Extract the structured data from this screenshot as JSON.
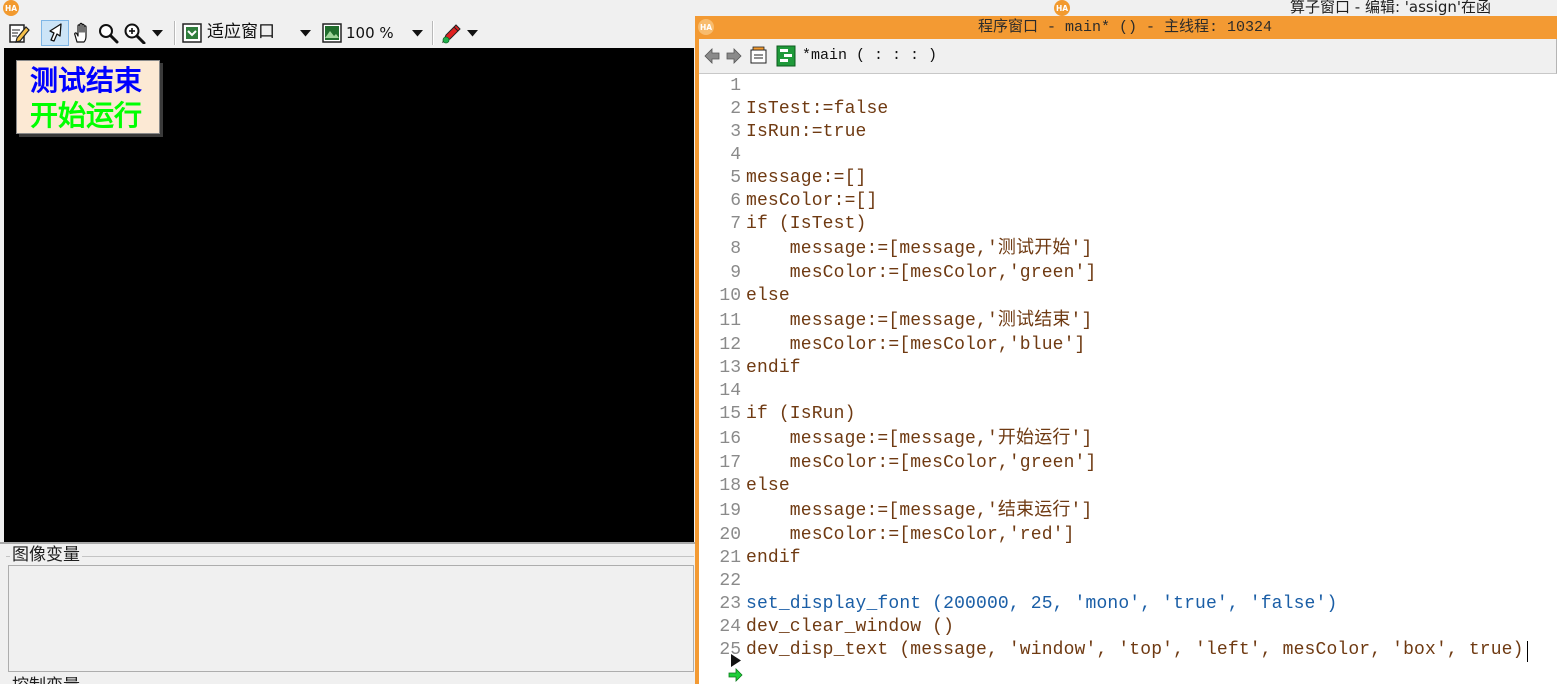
{
  "app": {
    "logo_text": "HA"
  },
  "top_strip": {
    "background_window_title": "算子窗口 - 编辑:  'assign'在函"
  },
  "graphics_window": {
    "toolbar": {
      "icons": [
        "edit-icon",
        "pointer-icon",
        "hand-icon",
        "magnifier-icon",
        "zoom-in-icon",
        "fit-window-icon",
        "image-zoom-icon",
        "draw-color-icon"
      ],
      "fit_window_label": "适应窗口",
      "zoom_label": "100 %"
    },
    "display": {
      "messages": [
        {
          "text": "测试结束",
          "color": "#0000ff"
        },
        {
          "text": "开始运行",
          "color": "#00ff00"
        }
      ]
    }
  },
  "variables_panel": {
    "image_variables_label": "图像变量",
    "control_variables_label": "控制变量"
  },
  "program_window": {
    "title": "程序窗口 - main* () - 主线程: 10324",
    "procedure_signature": "*main ( : : : )",
    "toolbar_icons": [
      "back-icon",
      "forward-icon",
      "edit-interface-icon",
      "procedure-icon"
    ],
    "code": {
      "lines": [
        {
          "n": 1,
          "text": "",
          "color": "#6f3a12"
        },
        {
          "n": 2,
          "text": "IsTest:=false",
          "color": "#6f3a12"
        },
        {
          "n": 3,
          "text": "IsRun:=true",
          "color": "#6f3a12"
        },
        {
          "n": 4,
          "text": "",
          "color": "#6f3a12"
        },
        {
          "n": 5,
          "text": "message:=[]",
          "color": "#6f3a12"
        },
        {
          "n": 6,
          "text": "mesColor:=[]",
          "color": "#6f3a12"
        },
        {
          "n": 7,
          "text": "if (IsTest)",
          "color": "#6f3a12"
        },
        {
          "n": 8,
          "text": "    message:=[message,'测试开始']",
          "color": "#6f3a12"
        },
        {
          "n": 9,
          "text": "    mesColor:=[mesColor,'green']",
          "color": "#6f3a12"
        },
        {
          "n": 10,
          "text": "else",
          "color": "#6f3a12"
        },
        {
          "n": 11,
          "text": "    message:=[message,'测试结束']",
          "color": "#6f3a12"
        },
        {
          "n": 12,
          "text": "    mesColor:=[mesColor,'blue']",
          "color": "#6f3a12"
        },
        {
          "n": 13,
          "text": "endif",
          "color": "#6f3a12"
        },
        {
          "n": 14,
          "text": "",
          "color": "#6f3a12"
        },
        {
          "n": 15,
          "text": "if (IsRun)",
          "color": "#6f3a12"
        },
        {
          "n": 16,
          "text": "    message:=[message,'开始运行']",
          "color": "#6f3a12"
        },
        {
          "n": 17,
          "text": "    mesColor:=[mesColor,'green']",
          "color": "#6f3a12"
        },
        {
          "n": 18,
          "text": "else",
          "color": "#6f3a12"
        },
        {
          "n": 19,
          "text": "    message:=[message,'结束运行']",
          "color": "#6f3a12"
        },
        {
          "n": 20,
          "text": "    mesColor:=[mesColor,'red']",
          "color": "#6f3a12"
        },
        {
          "n": 21,
          "text": "endif",
          "color": "#6f3a12"
        },
        {
          "n": 22,
          "text": "",
          "color": "#6f3a12"
        },
        {
          "n": 23,
          "text": "set_display_font (200000, 25, 'mono', 'true', 'false')",
          "color": "#1a5ea6"
        },
        {
          "n": 24,
          "text": "dev_clear_window ()",
          "color": "#6f3a12"
        },
        {
          "n": 25,
          "text": "dev_disp_text (message, 'window', 'top', 'left', mesColor, 'box', true)",
          "color": "#6f3a12"
        }
      ]
    }
  },
  "colors": {
    "program_window_accent": "#f39a33",
    "line_number": "#8a8a8a",
    "message_box_background": "#fce9d4",
    "display_background": "#000000",
    "active_tool_highlight": "#cce4f7",
    "logo": "#f29a2f",
    "logo_on_accent": "#f8bc6e"
  }
}
